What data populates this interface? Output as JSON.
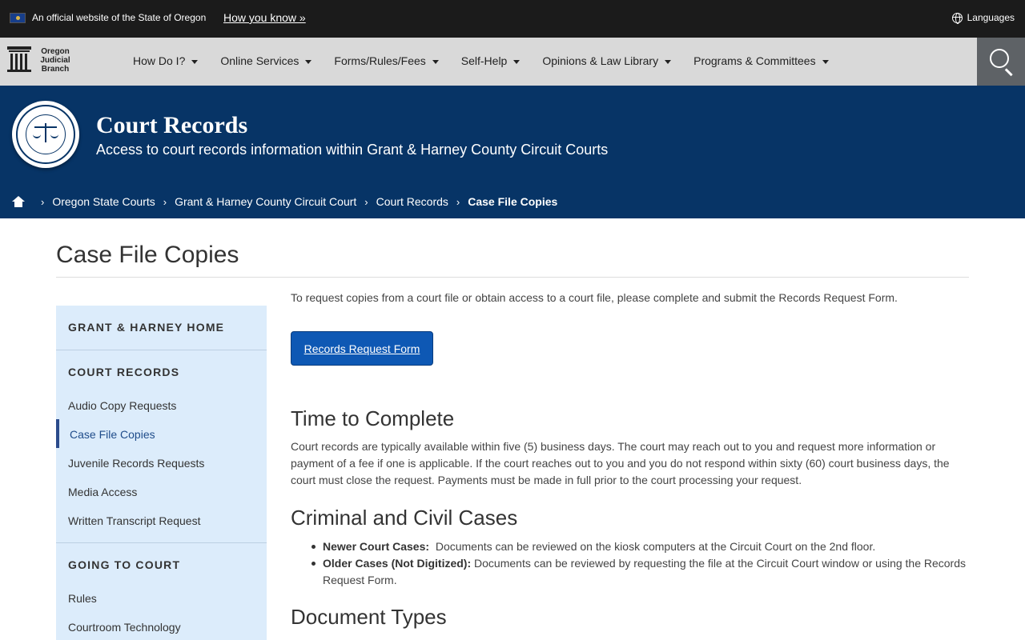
{
  "official_bar": {
    "text": "An official website of the State of Oregon",
    "how_link": "How you know »",
    "languages": "Languages"
  },
  "logo": {
    "line1": "Oregon",
    "line2": "Judicial",
    "line3": "Branch"
  },
  "nav": {
    "items": [
      {
        "label": "How Do I?"
      },
      {
        "label": "Online Services"
      },
      {
        "label": "Forms/Rules/Fees"
      },
      {
        "label": "Self-Help"
      },
      {
        "label": "Opinions & Law Library"
      },
      {
        "label": "Programs & Committees"
      }
    ]
  },
  "banner": {
    "title": "Court Records",
    "subtitle": "Access to court records information within Grant & Harney County Circuit Courts"
  },
  "breadcrumb": {
    "items": [
      "Oregon State Courts",
      "Grant & Harney County Circuit Court",
      "Court Records"
    ],
    "current": "Case File Copies"
  },
  "page": {
    "title": "Case File Copies"
  },
  "sidebar": {
    "home": "GRANT & HARNEY HOME",
    "section1": "COURT RECORDS",
    "links1": [
      "Audio Copy Requests",
      "Case File Copies",
      "Juvenile Records Requests",
      "Media Access",
      "Written Transcript Request"
    ],
    "section2": "GOING TO COURT",
    "links2": [
      "Rules",
      "Courtroom Technology"
    ]
  },
  "main": {
    "intro": "To request copies from a court file or obtain access to a court file, please complete and submit the Records Request Form.",
    "button": "Records Request Form",
    "h_time": "Time to Complete",
    "p_time": "Court records are typically available within five (5) business days. The court may reach out to you and request more information or payment of a fee if one is applicable. If the court reaches out to you and you do not respond within sixty (60) court business days, the court must close the request. Payments must be made in full prior to the court processing your request.",
    "h_criminal": "Criminal and Civil Cases",
    "bullet1_label": "Newer Court Cases:",
    "bullet1_text": "Documents can be reviewed on the kiosk computers at the Circuit Court on the 2nd floor.",
    "bullet2_label": "Older Cases (Not Digitized):",
    "bullet2_text": "Documents can be reviewed by requesting the file at the Circuit Court window or using the Records Request Form.",
    "h_doc": "Document Types"
  }
}
